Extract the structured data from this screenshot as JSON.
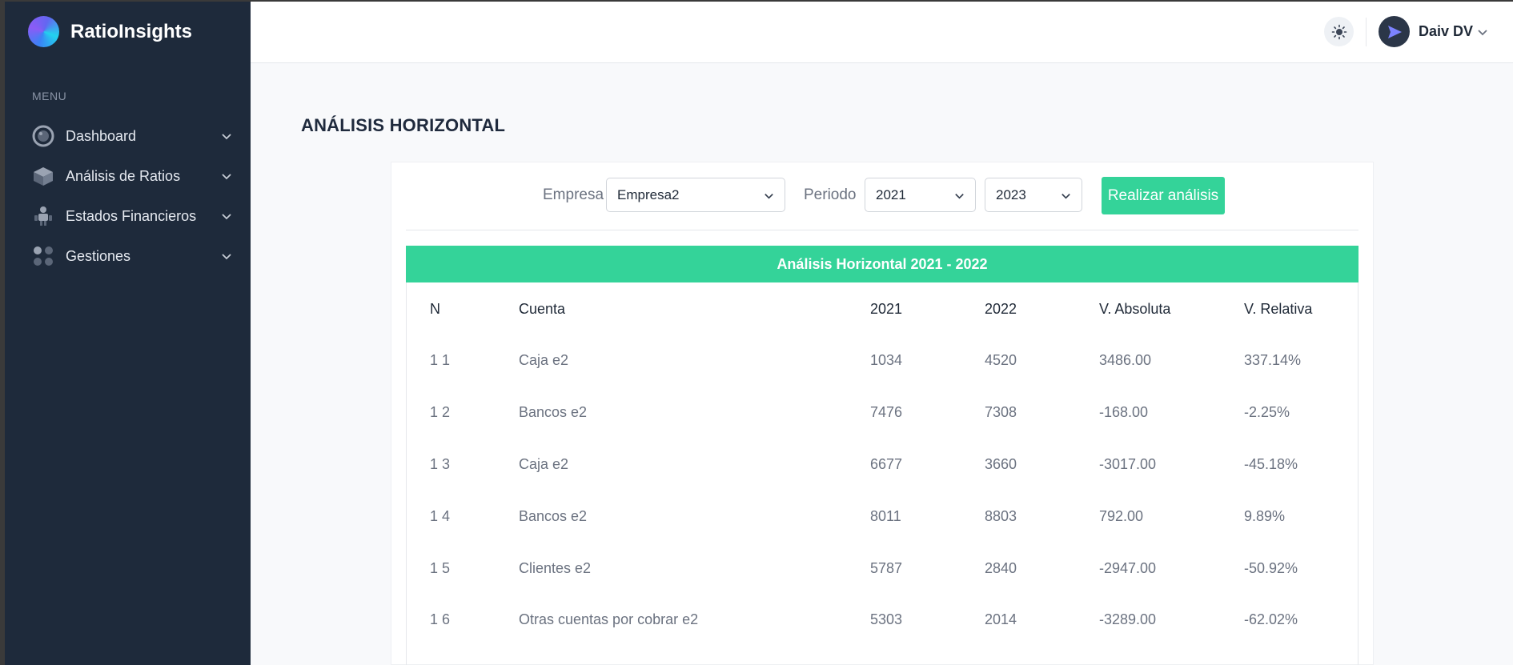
{
  "app": {
    "name": "RatioInsights"
  },
  "sidebar": {
    "menu_label": "MENU",
    "items": [
      {
        "label": "Dashboard",
        "icon": "dashboard-gauge-icon"
      },
      {
        "label": "Análisis de Ratios",
        "icon": "cube-icon"
      },
      {
        "label": "Estados Financieros",
        "icon": "people-icon"
      },
      {
        "label": "Gestiones",
        "icon": "apps-dots-icon"
      }
    ]
  },
  "header": {
    "user_name": "Daiv DV",
    "theme_icon": "sun-icon",
    "avatar_icon": "send-arrow-icon"
  },
  "page": {
    "title": "ANÁLISIS HORIZONTAL"
  },
  "filters": {
    "company_label": "Empresa",
    "company_value": "Empresa2",
    "period_label": "Periodo",
    "period_from": "2021",
    "period_to": "2023",
    "submit_label": "Realizar análisis"
  },
  "table": {
    "caption": "Análisis Horizontal 2021 - 2022",
    "headers": [
      "N",
      "Cuenta",
      "2021",
      "2022",
      "V. Absoluta",
      "V. Relativa"
    ],
    "rows": [
      [
        "1 1",
        "Caja e2",
        "1034",
        "4520",
        "3486.00",
        "337.14%"
      ],
      [
        "1 2",
        "Bancos e2",
        "7476",
        "7308",
        "-168.00",
        "-2.25%"
      ],
      [
        "1 3",
        "Caja e2",
        "6677",
        "3660",
        "-3017.00",
        "-45.18%"
      ],
      [
        "1 4",
        "Bancos e2",
        "8011",
        "8803",
        "792.00",
        "9.89%"
      ],
      [
        "1 5",
        "Clientes e2",
        "5787",
        "2840",
        "-2947.00",
        "-50.92%"
      ],
      [
        "1 6",
        "Otras cuentas por cobrar e2",
        "5303",
        "2014",
        "-3289.00",
        "-62.02%"
      ]
    ]
  },
  "colors": {
    "sidebar_bg": "#1e2a3b",
    "accent": "#34d399",
    "page_bg": "#f8f9fb"
  }
}
